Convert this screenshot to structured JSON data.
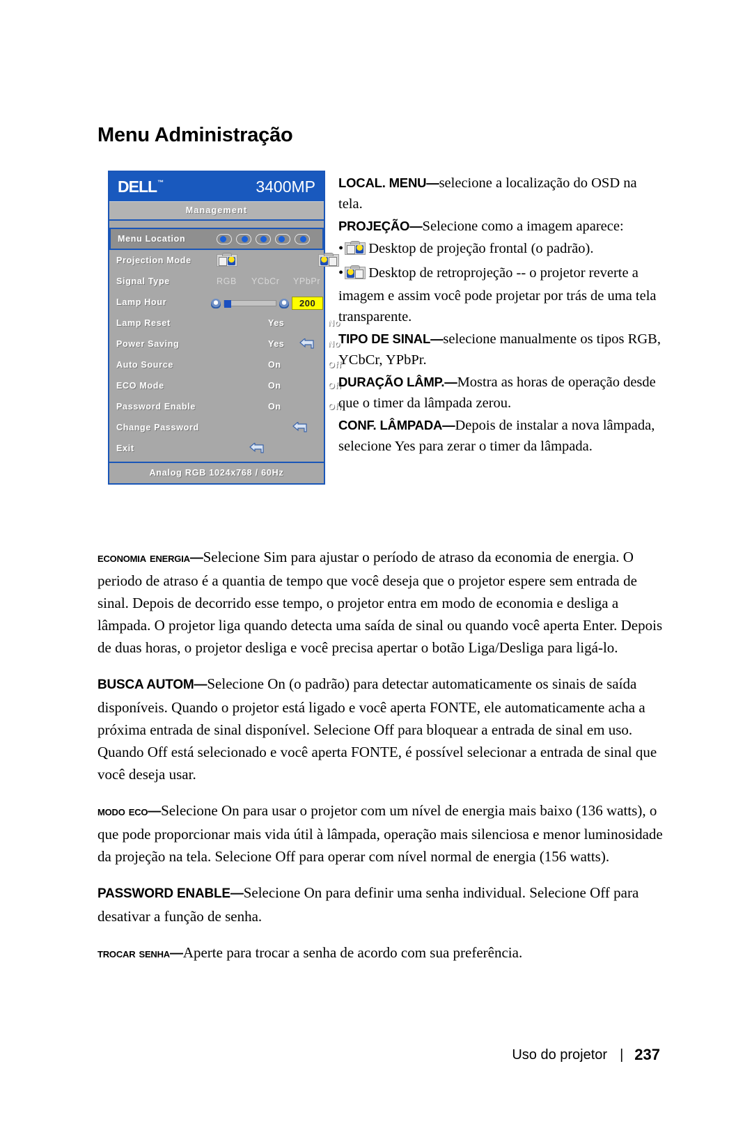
{
  "page_title": "Menu Administração",
  "osd": {
    "brand": "DELL",
    "brand_tm": "™",
    "model": "3400MP",
    "subtitle": "Management",
    "status_bar": "Analog RGB 1024x768 / 60Hz",
    "rows": [
      {
        "label": "Menu Location",
        "type": "pills",
        "selected": true
      },
      {
        "label": "Projection Mode",
        "type": "projection"
      },
      {
        "label": "Signal Type",
        "type": "values",
        "values": [
          "RGB",
          "YCbCr",
          "YPbPr"
        ]
      },
      {
        "label": "Lamp Hour",
        "type": "slider",
        "value": "200"
      },
      {
        "label": "Lamp Reset",
        "type": "values",
        "values": [
          "Yes",
          "No"
        ]
      },
      {
        "label": "Power Saving",
        "type": "values_enter",
        "values": [
          "Yes",
          "No"
        ]
      },
      {
        "label": "Auto Source",
        "type": "values",
        "values": [
          "On",
          "Off"
        ]
      },
      {
        "label": "ECO Mode",
        "type": "values",
        "values": [
          "On",
          "Off"
        ]
      },
      {
        "label": "Password Enable",
        "type": "values",
        "values": [
          "On",
          "Off"
        ]
      },
      {
        "label": "Change Password",
        "type": "enter"
      },
      {
        "label": "Exit",
        "type": "enter_left"
      }
    ]
  },
  "right_column": {
    "menu_location": {
      "term": "LOCAL. MENU",
      "dash": "—",
      "text": "selecione a localização do OSD na tela."
    },
    "projection": {
      "term": "PROJEÇÃO",
      "dash": "—",
      "text": "Selecione como a imagem aparece:",
      "bullet_front": "Desktop de projeção frontal (o padrão).",
      "bullet_rear": "Desktop de retroprojeção -- o projetor reverte a imagem e assim você pode projetar por trás de uma tela transparente."
    },
    "signal_type": {
      "term": "TIPO DE SINAL",
      "dash": "—",
      "text": "selecione manualmente os tipos RGB, YCbCr, YPbPr."
    },
    "lamp_hour": {
      "term": "DURAÇÃO LÂMP.",
      "dash": "—",
      "text": "Mostra as horas de operação desde que o timer da lâmpada zerou."
    },
    "lamp_reset": {
      "term": "CONF. LÂMPADA",
      "dash": "—",
      "text": "Depois de instalar a nova lâmpada, selecione Yes para zerar o timer da lâmpada."
    }
  },
  "body": {
    "power_saving": {
      "term": "Economia Energia",
      "dash": "—",
      "text": "Selecione Sim para ajustar o período de atraso da economia de energia. O periodo de atraso é a quantia de tempo que você deseja que o projetor espere sem entrada de sinal. Depois de decorrido esse tempo, o projetor entra em modo de economia e desliga a lâmpada. O projetor liga quando detecta uma saída de sinal ou quando você aperta Enter. Depois de duas horas, o projetor desliga e você precisa apertar o botão Liga/Desliga para ligá-lo."
    },
    "auto_source": {
      "term": "BUSCA AUTOM",
      "dash": "—",
      "text_1": "Selecione On (o padrão) para detectar automaticamente os sinais de saída disponíveis. Quando o projetor está ligado e você aperta ",
      "emphasis_1": "FONTE",
      "text_2": ", ele automaticamente acha a próxima entrada de sinal disponível. Selecione Off para bloquear a entrada de sinal em uso. Quando Off está selecionado e você aperta ",
      "emphasis_2": "FONTE",
      "text_3": ", é possível selecionar a entrada de sinal que você deseja usar."
    },
    "eco_mode": {
      "term": "Modo ECO",
      "dash": "—",
      "text": "Selecione On para usar o projetor com um nível de energia mais baixo (136 watts), o que pode proporcionar mais vida útil à lâmpada, operação mais silenciosa e menor luminosidade da projeção na tela. Selecione Off para operar com nível normal de energia (156 watts)."
    },
    "password_enable": {
      "term": "PASSWORD ENABLE",
      "dash": "—",
      "text": "Selecione On para definir uma senha individual. Selecione Off para desativar a função de senha."
    },
    "change_password": {
      "term": "Trocar Senha",
      "dash": "—",
      "text": "Aperte para trocar a senha de acordo com sua preferência."
    }
  },
  "footer": {
    "label": "Uso do projetor",
    "separator": "|",
    "page_number": "237"
  },
  "colors": {
    "osd_blue": "#1959be",
    "osd_border_blue": "#1a56b8",
    "osd_grey": "#a8a8a8",
    "osd_subtitle_grey": "#b3b3b3",
    "highlight_yellow": "#ffff00"
  }
}
